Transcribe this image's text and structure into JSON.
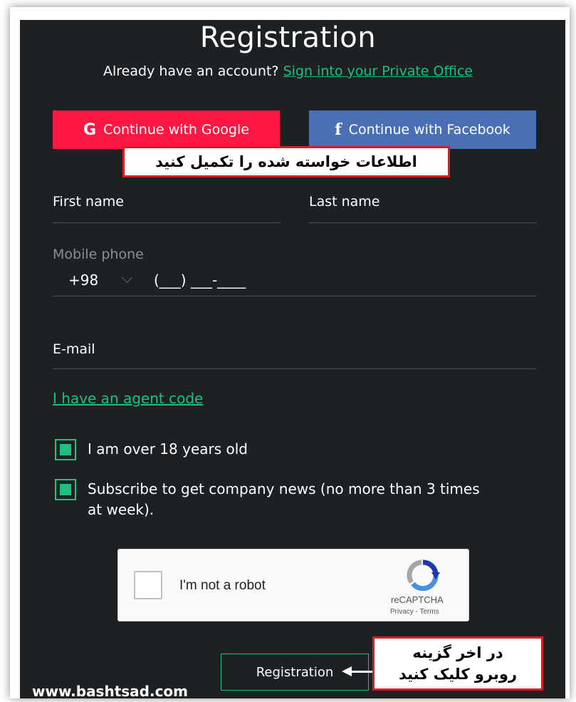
{
  "header": {
    "title": "Registration",
    "subtitle_prefix": "Already have an account?",
    "signin_link": "Sign into your Private Office"
  },
  "social": {
    "google_icon": "G",
    "google_label": "Continue with Google",
    "facebook_icon": "f",
    "facebook_label": "Continue with Facebook"
  },
  "annotation_top": "اطلاعات خواسته شده را تکمیل کنید",
  "form": {
    "first_name_label": "First name",
    "last_name_label": "Last name",
    "mobile_label": "Mobile phone",
    "phone_code": "+98",
    "phone_mask": "(___) ___-____",
    "email_label": "E-mail",
    "agent_link": "I have an agent code",
    "checkbox_age": "I am over 18 years old",
    "checkbox_news_line1": "Subscribe to get company news (no more than 3 times",
    "checkbox_news_line2": "at week)."
  },
  "recaptcha": {
    "label": "I'm not a robot",
    "brand": "reCAPTCHA",
    "terms": "Privacy - Terms"
  },
  "register_button": "Registration",
  "annotation_bottom_line1": "در اخر گزینه",
  "annotation_bottom_line2": "روبرو کلیک کنید",
  "watermark": "www.bashtsad.com",
  "colors": {
    "accent": "#1fbf7e",
    "google": "#ff1744",
    "facebook": "#4a6fb5",
    "panel": "#1e2124",
    "annotation_border": "#e01b1b"
  }
}
